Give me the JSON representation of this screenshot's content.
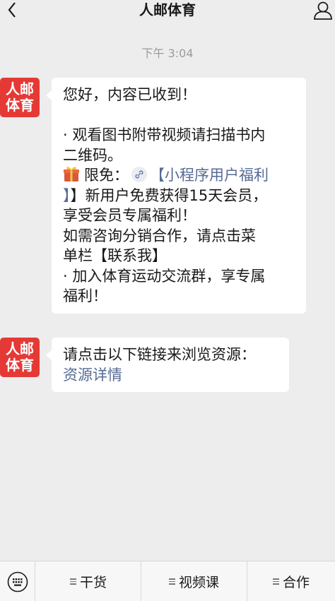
{
  "header": {
    "title": "人邮体育",
    "back_icon": "chevron-left-icon",
    "profile_icon": "user-icon"
  },
  "chat": {
    "timestamp": "下午 3:04",
    "avatar": {
      "line1": "人邮",
      "line2": "体育"
    },
    "messages": [
      {
        "lines": [
          "您好，内容已收到！",
          "",
          "· 观看图书附带视频请扫描书内",
          "二维码。"
        ],
        "gift_line": {
          "prefix": "限免：",
          "link_part1": "【小程序用户福利"
        },
        "lines_after": [
          "】新用户免费获得15天会员，",
          "享受会员专属福利！",
          "如需咨询分销合作，请点击菜",
          "单栏【联系我】",
          "· 加入体育运动交流群，享专属",
          "福利！"
        ]
      },
      {
        "text": "请点击以下链接来浏览资源：",
        "link": "资源详情"
      }
    ]
  },
  "menu": {
    "keyboard_icon": "keyboard-icon",
    "items": [
      "干货",
      "视频课",
      "合作"
    ]
  },
  "colors": {
    "background": "#ededed",
    "brand_red": "#e53935",
    "link": "#576b95"
  }
}
